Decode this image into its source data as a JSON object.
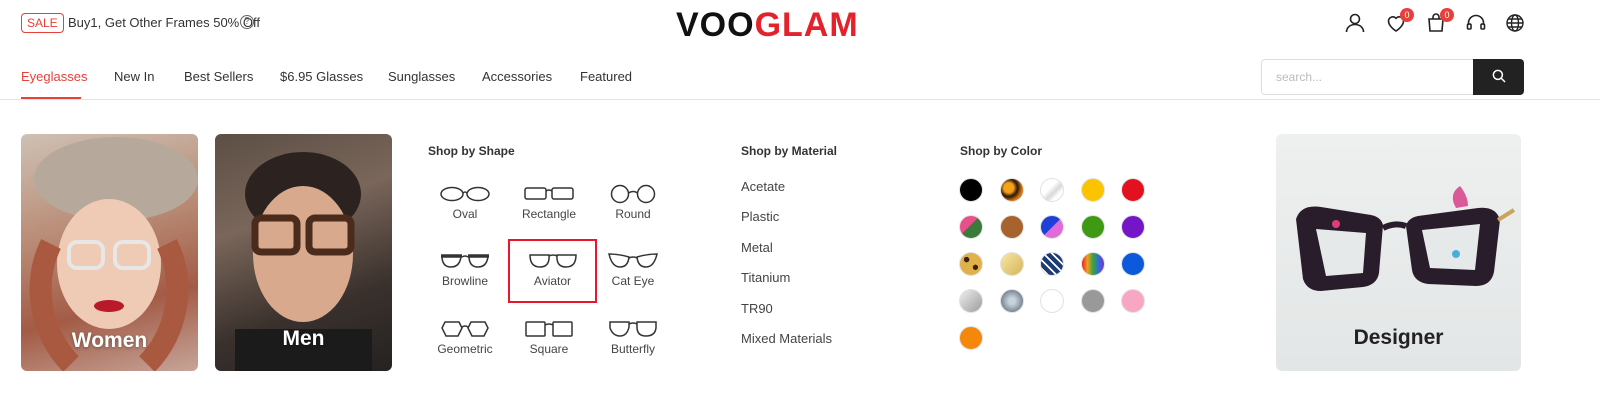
{
  "promo": {
    "badge": "SALE",
    "text": "Buy1, Get Other Frames 50% Off",
    "help_glyph": "?"
  },
  "logo": {
    "part1": "VOO",
    "part2": "GLAM",
    "dark_color": "#111111",
    "red_color": "#e3222b"
  },
  "header_icons": [
    {
      "name": "user-icon"
    },
    {
      "name": "heart-icon",
      "count": "0"
    },
    {
      "name": "cart-icon",
      "count": "0"
    },
    {
      "name": "headset-icon"
    },
    {
      "name": "globe-icon"
    }
  ],
  "nav": {
    "items": [
      {
        "label": "Eyeglasses",
        "active": true
      },
      {
        "label": "New In"
      },
      {
        "label": "Best Sellers"
      },
      {
        "label": "$6.95 Glasses"
      },
      {
        "label": "Sunglasses"
      },
      {
        "label": "Accessories"
      },
      {
        "label": "Featured"
      }
    ]
  },
  "search": {
    "placeholder": "search...",
    "value": "",
    "icon": "search-icon"
  },
  "categories": [
    {
      "label": "Women"
    },
    {
      "label": "Men"
    },
    {
      "label": "Designer"
    }
  ],
  "shop_by_shape": {
    "title": "Shop by Shape",
    "items": [
      {
        "label": "Oval"
      },
      {
        "label": "Rectangle"
      },
      {
        "label": "Round"
      },
      {
        "label": "Browline"
      },
      {
        "label": "Aviator",
        "selected": true
      },
      {
        "label": "Cat Eye"
      },
      {
        "label": "Geometric"
      },
      {
        "label": "Square"
      },
      {
        "label": "Butterfly"
      }
    ]
  },
  "shop_by_material": {
    "title": "Shop by Material",
    "items": [
      "Acetate",
      "Plastic",
      "Metal",
      "Titanium",
      "TR90",
      "Mixed Materials"
    ]
  },
  "shop_by_color": {
    "title": "Shop by Color",
    "swatches": [
      {
        "name": "black",
        "color": "#000000"
      },
      {
        "name": "tortoise",
        "color": "#6b3a10"
      },
      {
        "name": "clear",
        "color": "#f5f5f5"
      },
      {
        "name": "yellow",
        "color": "#fcc400"
      },
      {
        "name": "red",
        "color": "#e3101f"
      },
      {
        "name": "floral",
        "color": "#3a7a3a"
      },
      {
        "name": "brown",
        "color": "#a8622e"
      },
      {
        "name": "blue-pink",
        "color": "#1e3fd8"
      },
      {
        "name": "green",
        "color": "#3d9a12"
      },
      {
        "name": "purple",
        "color": "#7416c8"
      },
      {
        "name": "leopard",
        "color": "#c8a23a"
      },
      {
        "name": "gold",
        "color": "#e5cd7a"
      },
      {
        "name": "pattern",
        "color": "#1c3a73"
      },
      {
        "name": "multicolor",
        "color": "#f0a020"
      },
      {
        "name": "blue",
        "color": "#0d59dc"
      },
      {
        "name": "silver",
        "color": "#bfbfbf"
      },
      {
        "name": "glitter",
        "color": "#8d9aa7"
      },
      {
        "name": "white",
        "color": "#ffffff"
      },
      {
        "name": "gray",
        "color": "#999999"
      },
      {
        "name": "pink",
        "color": "#f7a6c3"
      },
      {
        "name": "orange",
        "color": "#f5870a"
      }
    ]
  }
}
